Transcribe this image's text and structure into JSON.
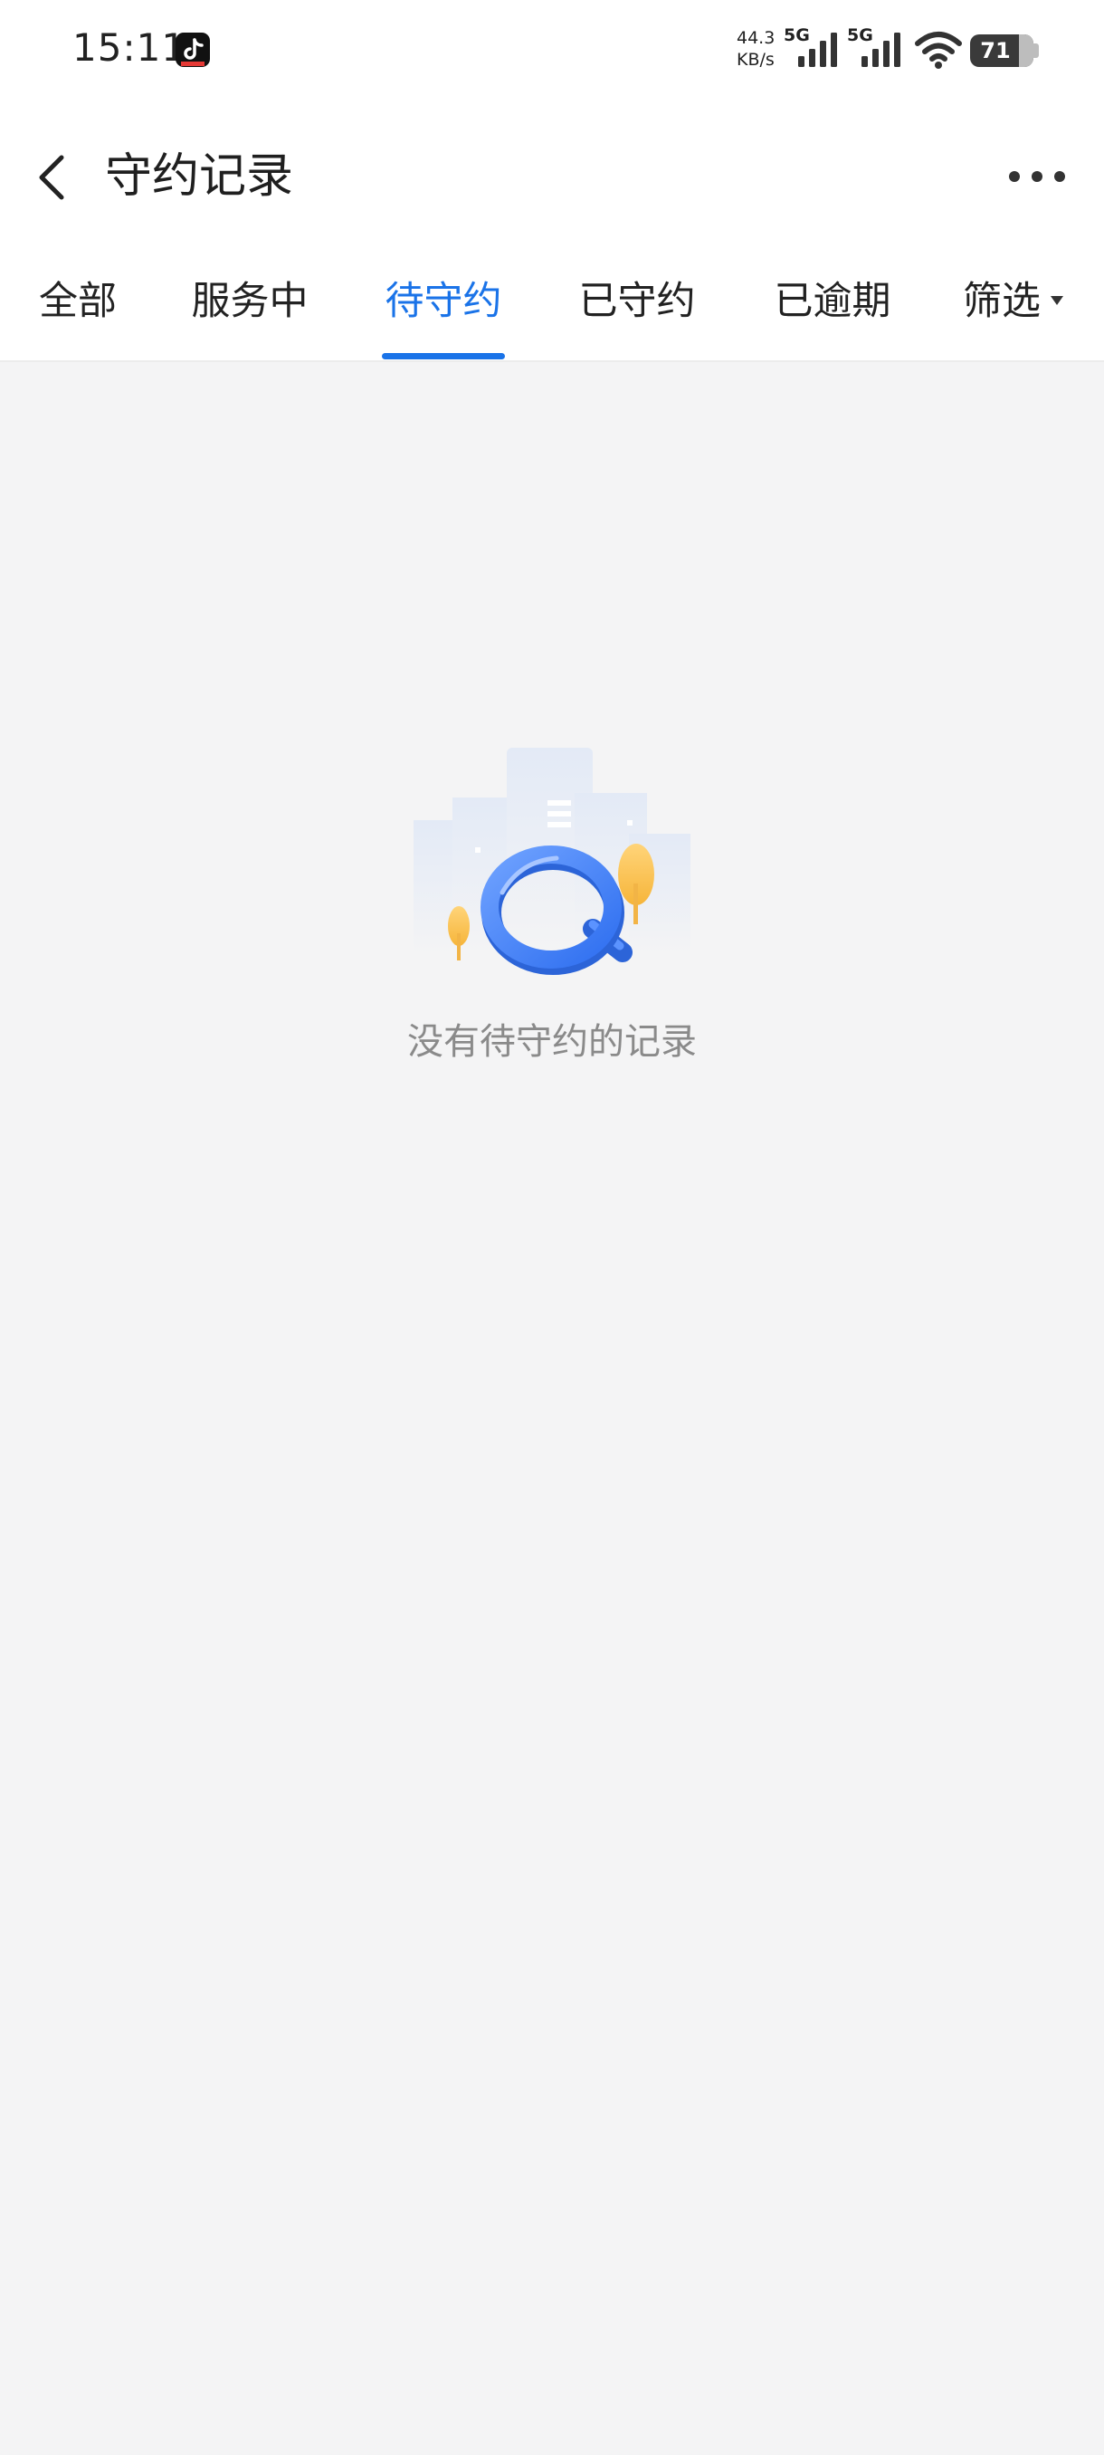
{
  "status_bar": {
    "time": "15:11",
    "net_speed_value": "44.3",
    "net_speed_unit": "KB/s",
    "signal_1_label": "5G",
    "signal_2_label": "5G",
    "battery_level": "71"
  },
  "header": {
    "title": "守约记录"
  },
  "tabs": [
    {
      "label": "全部"
    },
    {
      "label": "服务中"
    },
    {
      "label": "待守约"
    },
    {
      "label": "已守约"
    },
    {
      "label": "已逾期"
    },
    {
      "label": "筛选"
    }
  ],
  "active_tab": "待守约",
  "empty_state": {
    "message": "没有待守约的记录"
  },
  "colors": {
    "accent": "#1a73e8",
    "background": "#f4f4f5",
    "header_bg": "#ffffff",
    "empty_text": "#8a8a8a"
  }
}
